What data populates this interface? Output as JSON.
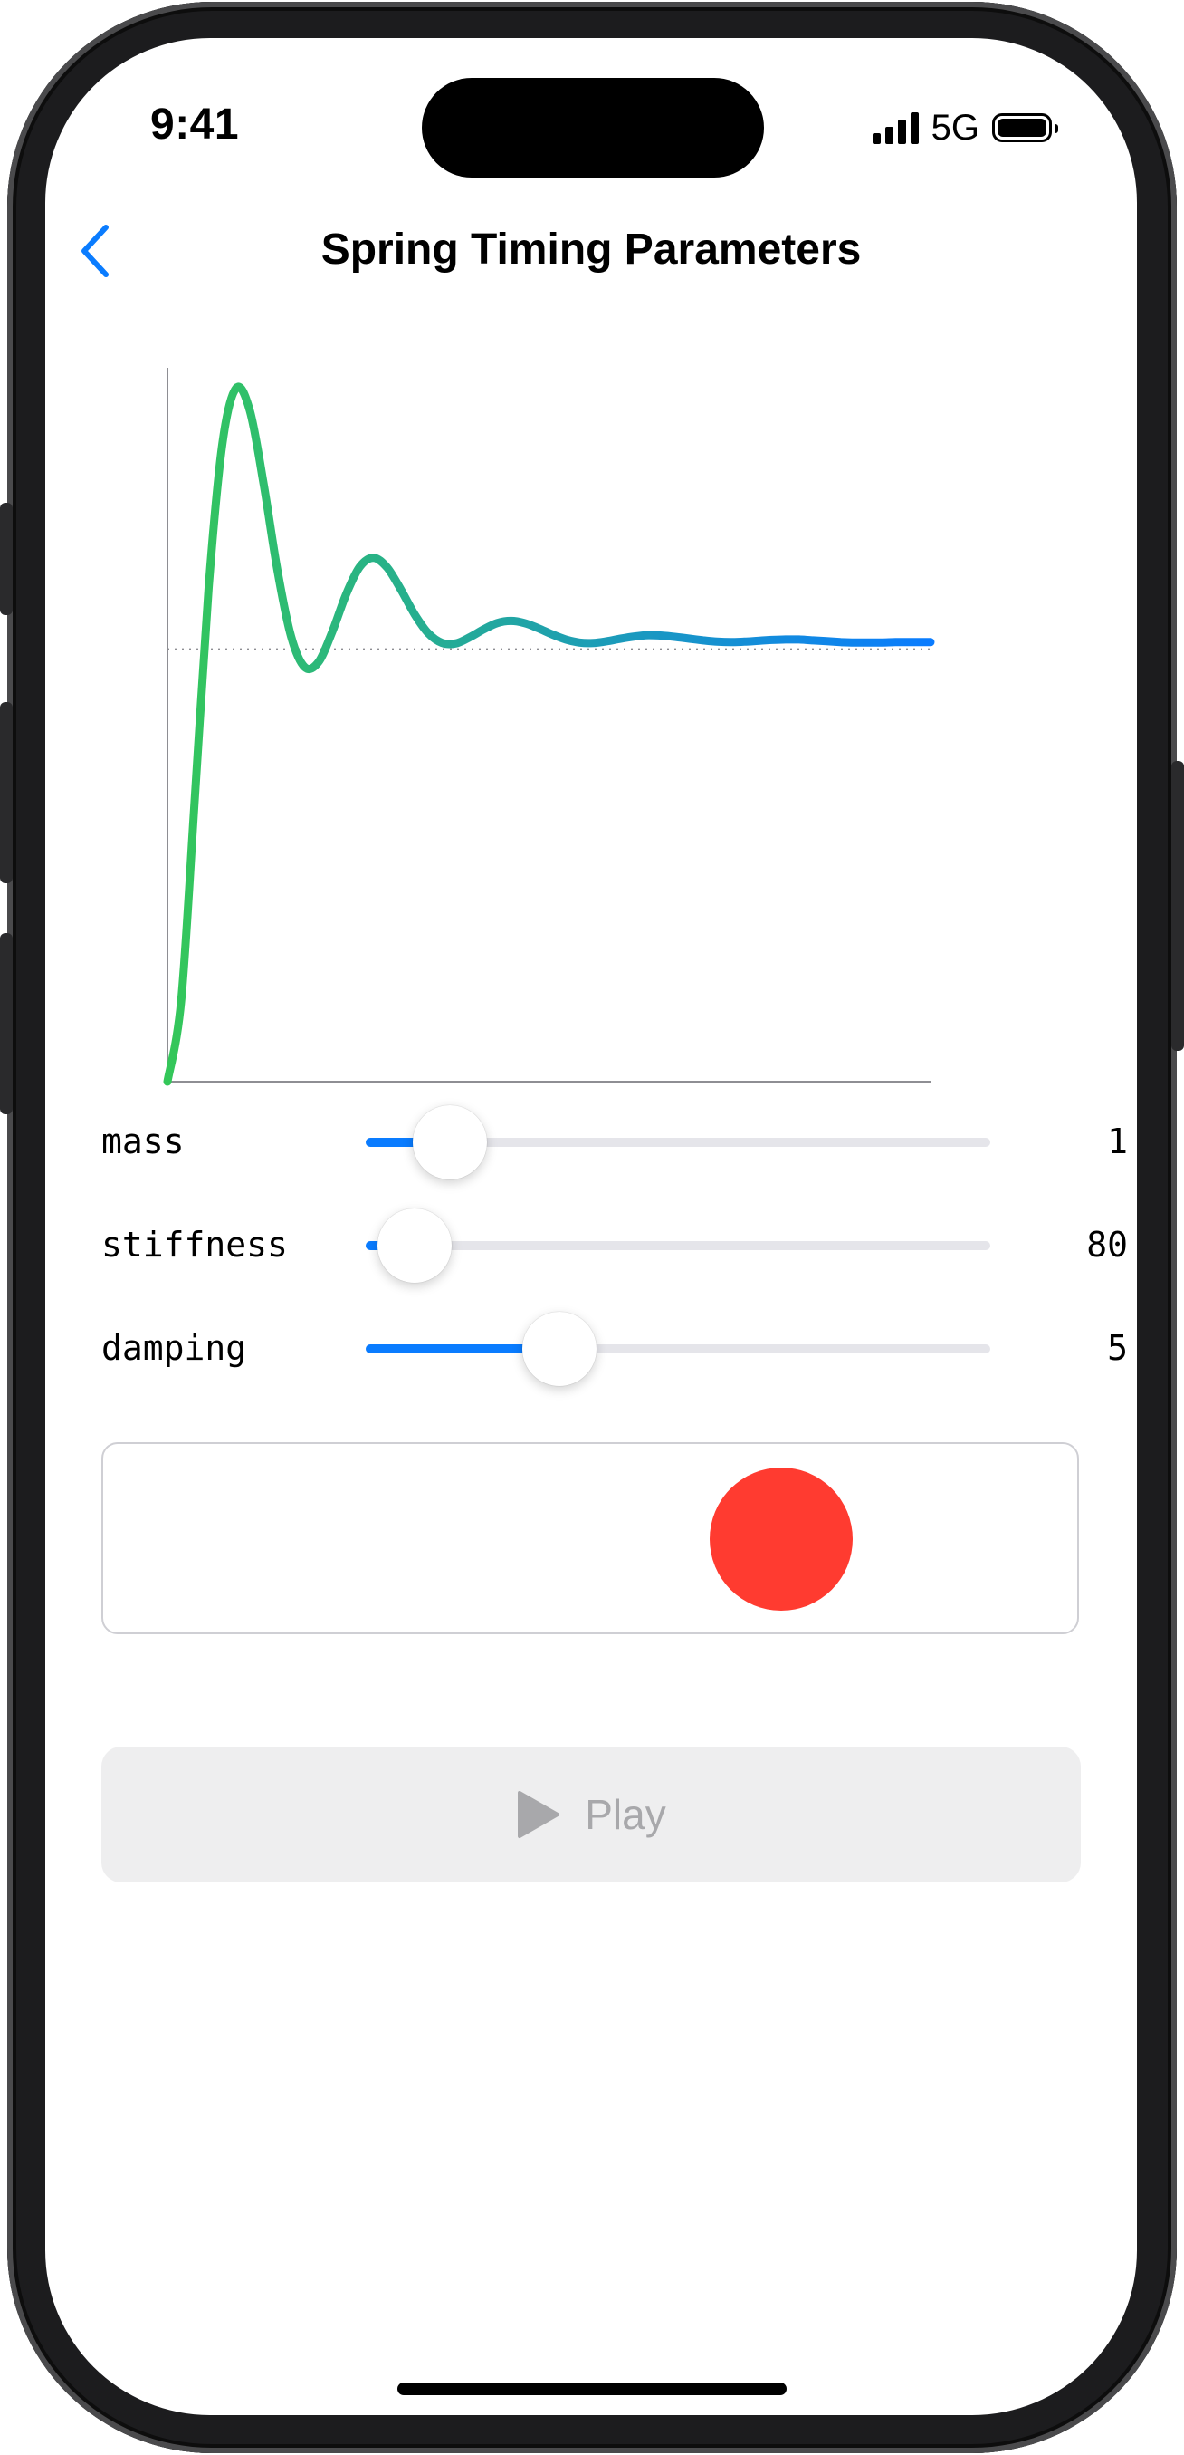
{
  "status_bar": {
    "time": "9:41",
    "network": "5G",
    "signal_bars": 4,
    "battery_level": 1.0
  },
  "nav": {
    "title": "Spring Timing Parameters",
    "back_icon": "chevron-left-icon",
    "accent_color": "#0a7cff"
  },
  "chart_data": {
    "type": "line",
    "title": "",
    "xlabel": "",
    "ylabel": "",
    "y_target": 1,
    "reference_line": "dotted",
    "x_range": [
      0,
      1
    ],
    "ylim": [
      0,
      1.65
    ],
    "gradient": [
      "#34c759",
      "#0a7cff"
    ],
    "x": [
      0,
      0.018,
      0.036,
      0.054,
      0.072,
      0.09,
      0.108,
      0.126,
      0.144,
      0.162,
      0.18,
      0.198,
      0.216,
      0.234,
      0.252,
      0.27,
      0.288,
      0.306,
      0.324,
      0.342,
      0.36,
      0.378,
      0.396,
      0.414,
      0.432,
      0.45,
      0.468,
      0.486,
      0.504,
      0.522,
      0.54,
      0.558,
      0.576,
      0.594,
      0.612,
      0.63,
      0.648,
      0.666,
      0.684,
      0.702,
      0.72,
      0.738,
      0.756,
      0.774,
      0.792,
      0.81,
      0.828,
      0.846,
      0.864,
      0.882,
      0.9,
      0.918,
      0.936,
      0.954,
      0.972,
      1.0
    ],
    "y": [
      0.0,
      0.188,
      0.658,
      1.142,
      1.475,
      1.603,
      1.551,
      1.382,
      1.183,
      1.029,
      0.958,
      0.97,
      1.04,
      1.126,
      1.19,
      1.211,
      1.188,
      1.137,
      1.08,
      1.036,
      1.014,
      1.013,
      1.027,
      1.045,
      1.06,
      1.065,
      1.06,
      1.048,
      1.034,
      1.022,
      1.015,
      1.014,
      1.018,
      1.024,
      1.029,
      1.032,
      1.031,
      1.028,
      1.024,
      1.02,
      1.017,
      1.016,
      1.017,
      1.019,
      1.021,
      1.022,
      1.022,
      1.02,
      1.018,
      1.016,
      1.015,
      1.015,
      1.015,
      1.016,
      1.016,
      1.016
    ]
  },
  "params": [
    {
      "label": "mass",
      "value": "1",
      "fraction": 0.135
    },
    {
      "label": "stiffness",
      "value": "80",
      "fraction": 0.078
    },
    {
      "label": "damping",
      "value": "5",
      "fraction": 0.31
    }
  ],
  "preview": {
    "ball_color": "#ff3b30"
  },
  "play_button": {
    "label": "Play",
    "icon": "play-icon",
    "enabled": false
  }
}
